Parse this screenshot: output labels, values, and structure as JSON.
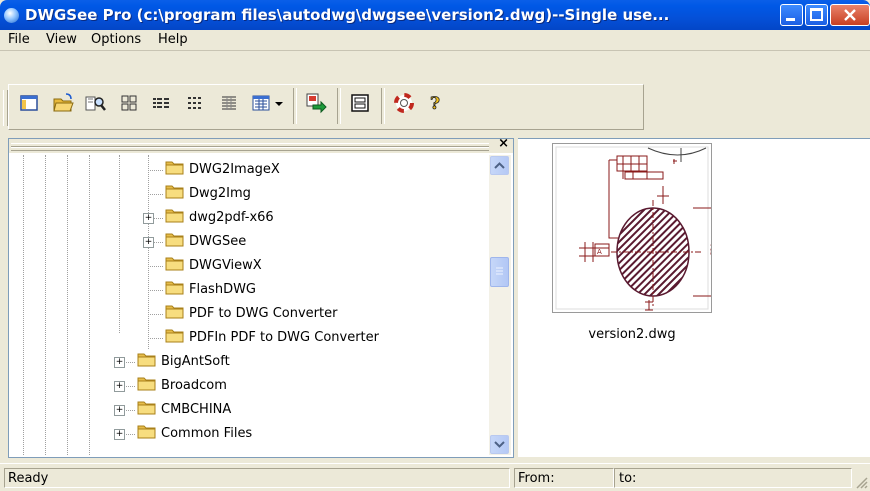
{
  "window": {
    "title": "DWGSee Pro (c:\\program files\\autodwg\\dwgsee\\version2.dwg)--Single use...",
    "controls": [
      "minimize",
      "maximize",
      "close"
    ]
  },
  "menu": [
    "File",
    "View",
    "Options",
    "Help"
  ],
  "toolbar": {
    "buttons": [
      "browser-pane-icon",
      "open-folder-icon",
      "find-files-icon",
      "large-icons-icon",
      "list-view-icon",
      "small-icons-icon",
      "details-view-icon",
      "thumbnail-view-icon",
      "view-dropdown-icon",
      "convert-icon",
      "window-icon",
      "help-lifebuoy-icon",
      "about-icon"
    ]
  },
  "tree": {
    "items": [
      {
        "label": "DWG2ImageX",
        "expandable": false
      },
      {
        "label": "Dwg2Img",
        "expandable": false
      },
      {
        "label": "dwg2pdf-x66",
        "expandable": true
      },
      {
        "label": "DWGSee",
        "expandable": true
      },
      {
        "label": "DWGViewX",
        "expandable": false
      },
      {
        "label": "FlashDWG",
        "expandable": false
      },
      {
        "label": "PDF to DWG Converter",
        "expandable": false
      },
      {
        "label": "PDFIn PDF to DWG Converter",
        "expandable": false
      },
      {
        "label": "BigAntSoft",
        "expandable": true
      },
      {
        "label": "Broadcom",
        "expandable": true
      },
      {
        "label": "CMBCHINA",
        "expandable": true
      },
      {
        "label": "Common Files",
        "expandable": true
      }
    ]
  },
  "preview": {
    "caption": "version2.dwg"
  },
  "status": {
    "state": "Ready",
    "from_label": "From:",
    "to_label": "to:"
  },
  "colors": {
    "titlebar": "#0450d8",
    "folder": "#f5d76b",
    "hatch": "#5a1a30"
  }
}
